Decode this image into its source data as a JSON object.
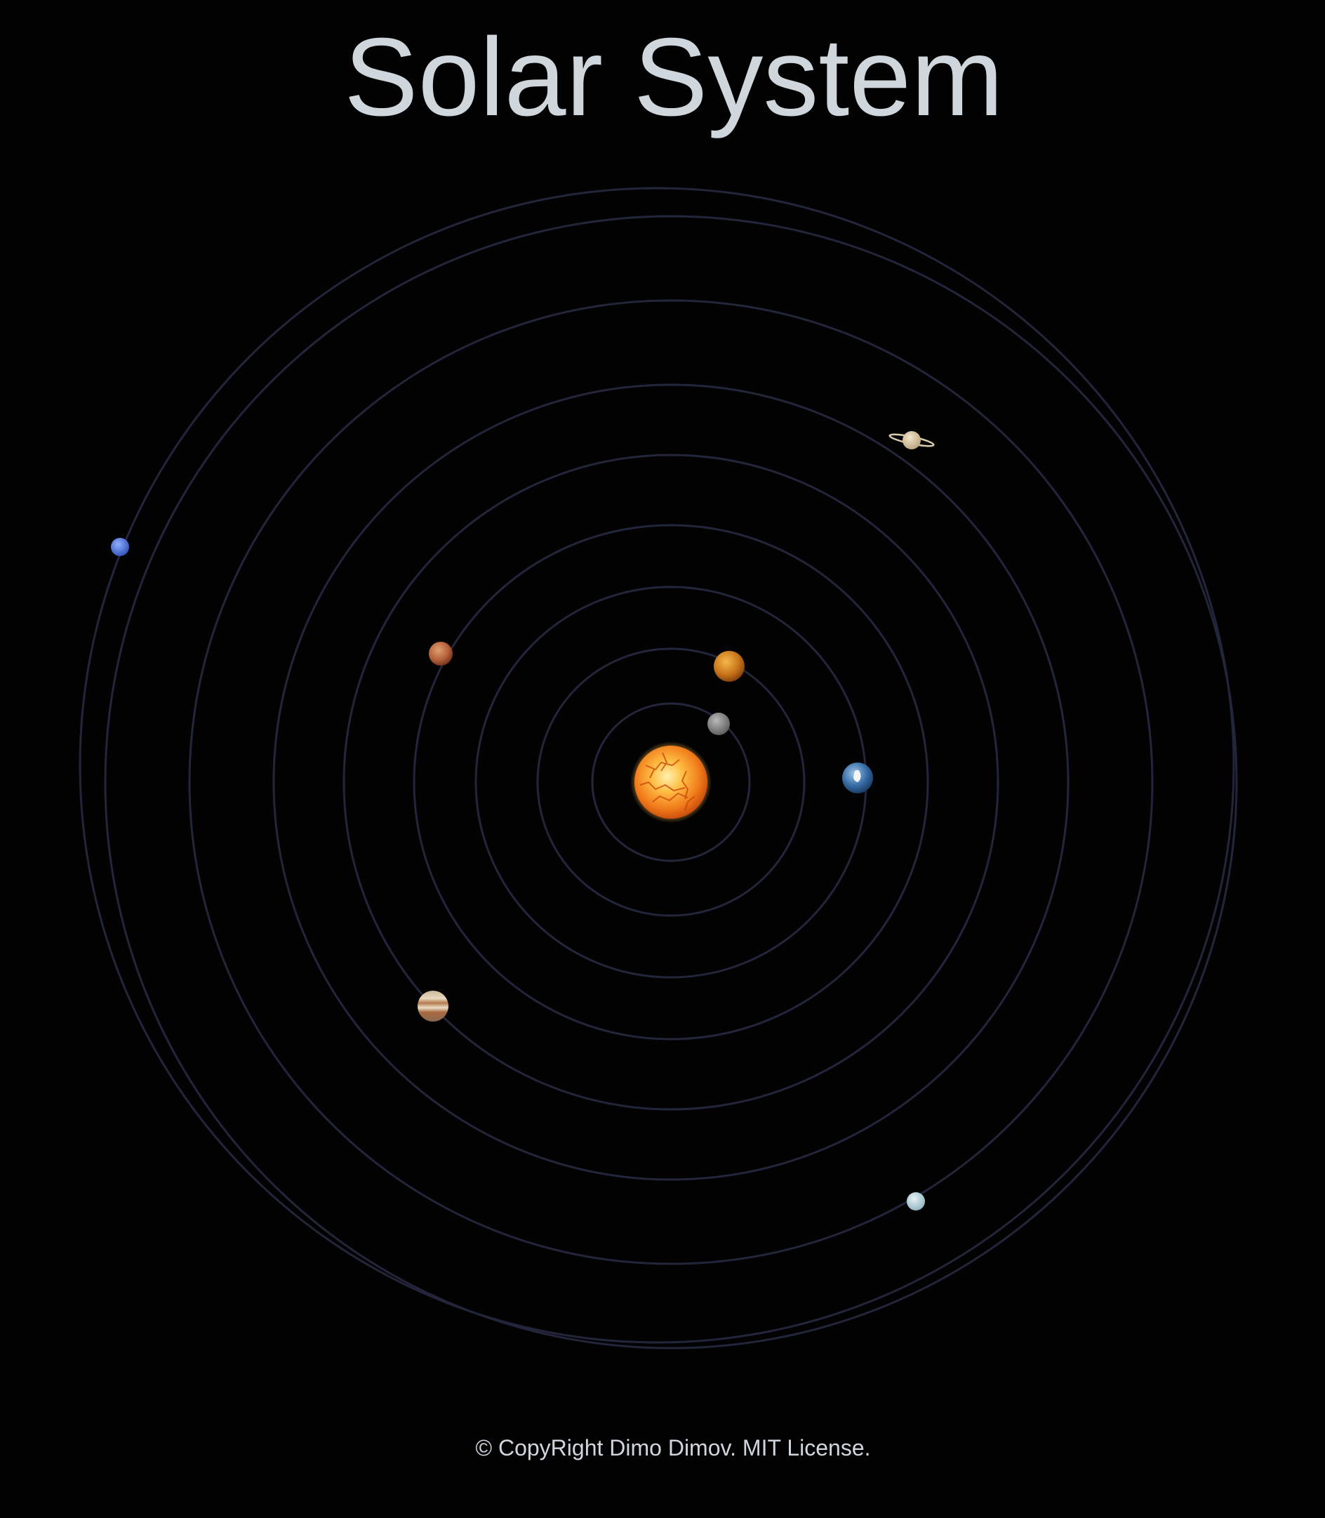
{
  "title": "Solar System",
  "footer": "© CopyRight Dimo Dimov. MIT License.",
  "colors": {
    "background": "#020203",
    "title_text": "#cfd6dc",
    "orbit_stroke": "#23263a"
  },
  "bodies": [
    {
      "name": "sun",
      "icon": "sun-icon"
    },
    {
      "name": "mercury",
      "icon": "planet-mercury-icon"
    },
    {
      "name": "venus",
      "icon": "planet-venus-icon"
    },
    {
      "name": "earth",
      "icon": "planet-earth-icon"
    },
    {
      "name": "mars",
      "icon": "planet-mars-icon"
    },
    {
      "name": "jupiter",
      "icon": "planet-jupiter-icon"
    },
    {
      "name": "saturn",
      "icon": "planet-saturn-icon"
    },
    {
      "name": "uranus",
      "icon": "planet-uranus-icon"
    },
    {
      "name": "neptune",
      "icon": "planet-neptune-icon"
    }
  ]
}
